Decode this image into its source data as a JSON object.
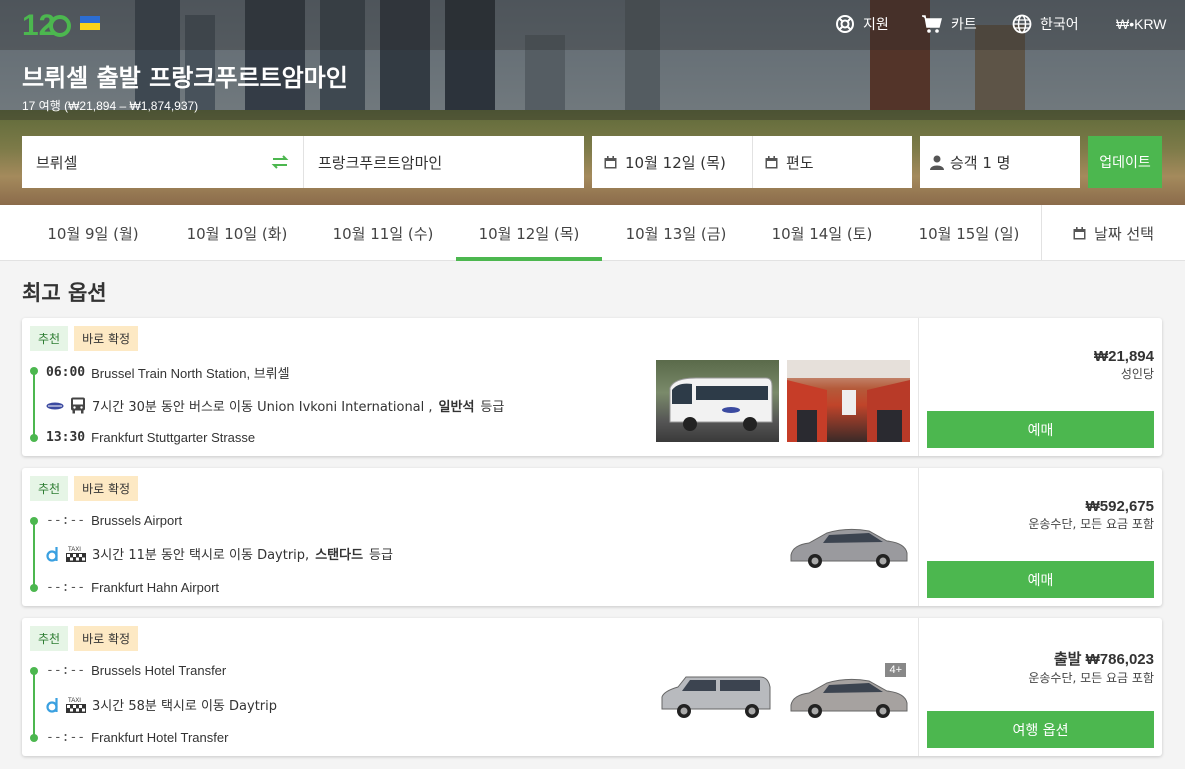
{
  "header": {
    "support": "지원",
    "cart": "카트",
    "language": "한국어",
    "currency": "₩•KRW",
    "title": "브뤼셀 출발 프랑크푸르트암마인",
    "subtitle": "17 여행 (₩21,894 – ₩1,874,937)"
  },
  "search": {
    "from": "브뤼셀",
    "to": "프랑크푸르트암마인",
    "date": "10월 12일 (목)",
    "return": "편도",
    "passengers": "승객 1 명",
    "update": "업데이트"
  },
  "date_tabs": [
    {
      "label": "10월 9일 (월)"
    },
    {
      "label": "10월 10일 (화)"
    },
    {
      "label": "10월 11일 (수)"
    },
    {
      "label": "10월 12일 (목)"
    },
    {
      "label": "10월 13일 (금)"
    },
    {
      "label": "10월 14일 (토)"
    },
    {
      "label": "10월 15일 (일)"
    }
  ],
  "active_tab": 3,
  "pick_date": "날짜 선택",
  "section_title": "최고 옵션",
  "colors": {
    "accent": "#4cb74f",
    "badge_rec": "#e6f5e6",
    "badge_conf": "#fde9c4"
  },
  "results": [
    {
      "badge_rec": "추천",
      "badge_conf": "바로 확정",
      "dep_time": "06:00",
      "dep_place": "Brussel Train North Station, 브뤼셀",
      "mid_text": "7시간 30분 동안 버스로 이동 Union Ivkoni International ,",
      "mid_class": "일반석",
      "mid_suffix": "등급",
      "arr_time": "13:30",
      "arr_place": "Frankfurt Stuttgarter Strasse",
      "price": "₩21,894",
      "price_note": "성인당",
      "button": "예매"
    },
    {
      "badge_rec": "추천",
      "badge_conf": "바로 확정",
      "dep_time": "--:--",
      "dep_place": "Brussels Airport",
      "mid_text": "3시간 11분 동안 택시로 이동 Daytrip,",
      "mid_class": "스탠다드",
      "mid_suffix": "등급",
      "arr_time": "--:--",
      "arr_place": "Frankfurt Hahn Airport",
      "price": "₩592,675",
      "price_note": "운송수단, 모든 요금 포함",
      "button": "예매"
    },
    {
      "badge_rec": "추천",
      "badge_conf": "바로 확정",
      "dep_time": "--:--",
      "dep_place": "Brussels Hotel Transfer",
      "mid_text": "3시간 58분 택시로 이동 Daytrip",
      "arr_time": "--:--",
      "arr_place": "Frankfurt Hotel Transfer",
      "price": "출발 ₩786,023",
      "price_note": "운송수단, 모든 요금 포함",
      "plus": "4+",
      "button": "여행 옵션"
    }
  ]
}
